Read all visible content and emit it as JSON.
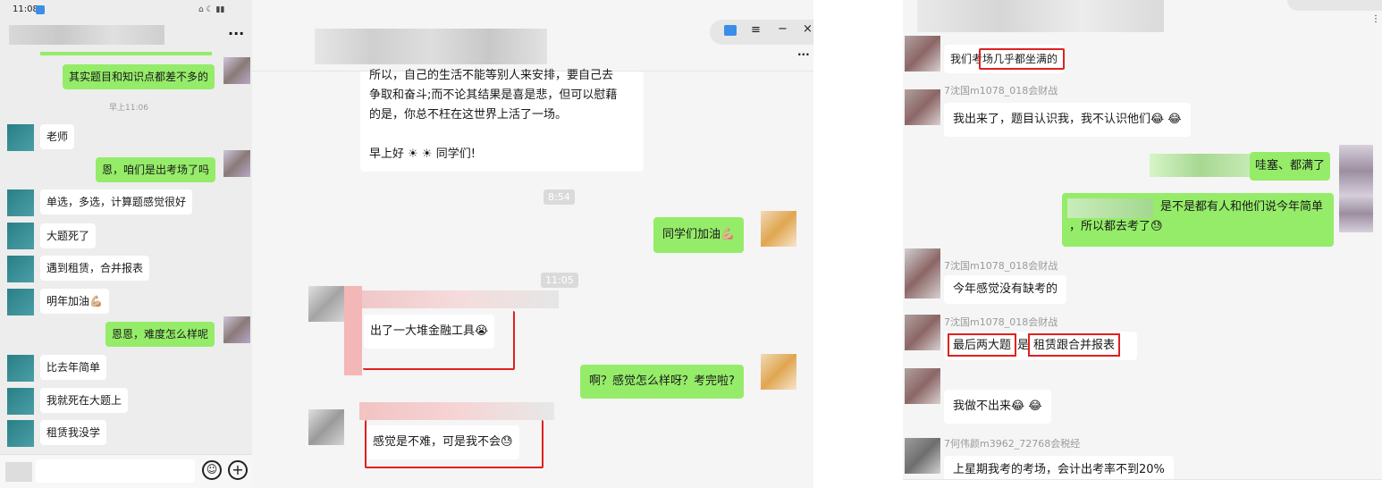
{
  "phone": {
    "status_time": "11:08",
    "more_icon": "more-dots-icon",
    "messages": [
      {
        "side": "right",
        "text": "其实题目和知识点都差不多的"
      },
      {
        "type": "time",
        "text": "早上11:06"
      },
      {
        "side": "left",
        "text": "老师"
      },
      {
        "side": "right",
        "text": "恩，咱们是出考场了吗"
      },
      {
        "side": "left",
        "text": "单选，多选，计算题感觉很好"
      },
      {
        "side": "left",
        "text": "大题死了"
      },
      {
        "side": "left",
        "text": "遇到租赁，合并报表"
      },
      {
        "side": "left",
        "text": "明年加油💪🏼"
      },
      {
        "side": "right",
        "text": "恩恩，难度怎么样呢"
      },
      {
        "side": "left",
        "text": "比去年简单"
      },
      {
        "side": "left",
        "text": "我就死在大题上"
      },
      {
        "side": "left",
        "text": "租赁我没学"
      }
    ],
    "input_placeholder": "",
    "emoji_icon": "emoji-icon",
    "add_icon": "plus-circle-icon"
  },
  "desk1": {
    "long_message_lines": [
      "所以，自己的生活不能等别人来安排，要自己去",
      "争取和奋斗;而不论其结果是喜是悲，但可以慰藉",
      "的是，你总不枉在这世界上活了一场。",
      "",
      "早上好 ☀ ☀ 同学们!"
    ],
    "time1": "8:54",
    "msg_cheer": "同学们加油💪🏼",
    "time2": "11:05",
    "msg_tools": "出了一大堆金融工具😭",
    "msg_how": "啊？感觉怎么样呀？考完啦?",
    "msg_hard": "感觉是不难，可是我不会😓"
  },
  "desk2": {
    "m1": "我们考场几乎都坐满的",
    "name1": "7沈国m1078_018会财战",
    "m2": "我出来了，题目认识我，我不认识他们😂 😂",
    "m3": "哇塞、都满了",
    "m4_line1": "是不是都有人和他们说今年简单",
    "m4_line2": "，所以都去考了😓",
    "name2": "7沈国m1078_018会财战",
    "m5": "今年感觉没有缺考的",
    "name3": "7沈国m1078_018会财战",
    "m6a": "最后两大题",
    "m6b": "是",
    "m6c": "租赁跟合并报表",
    "m7": "我做不出来😂 😂",
    "name4": "7何伟颜m3962_72768会税经",
    "m8": "上星期我考的考场，会计出考率不到20%"
  }
}
